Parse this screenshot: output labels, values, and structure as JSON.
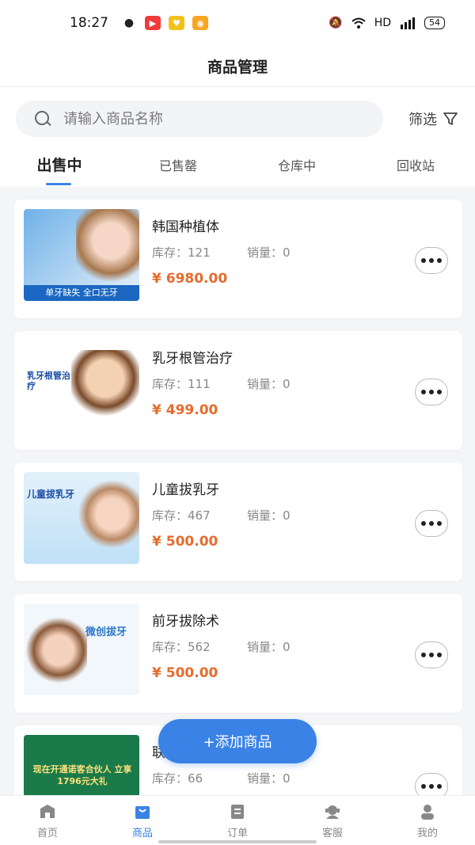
{
  "status_bar": {
    "time": "18:27",
    "network": "HD",
    "battery": "54"
  },
  "header": {
    "title": "商品管理"
  },
  "search": {
    "placeholder": "请输入商品名称",
    "filter_label": "筛选"
  },
  "tabs": [
    {
      "label": "出售中",
      "active": true
    },
    {
      "label": "已售罄",
      "active": false
    },
    {
      "label": "仓库中",
      "active": false
    },
    {
      "label": "回收站",
      "active": false
    }
  ],
  "products": [
    {
      "name": "韩国种植体",
      "stock_label": "库存：121",
      "sales_label": "销量：0",
      "price": "¥ 6980.00",
      "thumb_text": "单牙缺失 全口无牙"
    },
    {
      "name": "乳牙根管治疗",
      "stock_label": "库存：111",
      "sales_label": "销量：0",
      "price": "¥ 499.00",
      "thumb_text": "乳牙根管治疗"
    },
    {
      "name": "儿童拔乳牙",
      "stock_label": "库存：467",
      "sales_label": "销量：0",
      "price": "¥ 500.00",
      "thumb_text": "儿童拔乳牙"
    },
    {
      "name": "前牙拔除术",
      "stock_label": "库存：562",
      "sales_label": "销量：0",
      "price": "¥ 500.00",
      "thumb_text": "微创拔牙"
    },
    {
      "name": "联",
      "stock_label": "库存：66",
      "sales_label": "销量：0",
      "price": "",
      "thumb_text": "现在开通诺客合伙人 立享1796元大礼"
    }
  ],
  "add_button": {
    "label": "+添加商品"
  },
  "bottom_nav": [
    {
      "label": "首页",
      "icon": "home-icon",
      "active": false
    },
    {
      "label": "商品",
      "icon": "bag-icon",
      "active": true
    },
    {
      "label": "订单",
      "icon": "order-icon",
      "active": false
    },
    {
      "label": "客服",
      "icon": "service-icon",
      "active": false
    },
    {
      "label": "我的",
      "icon": "profile-icon",
      "active": false
    }
  ],
  "colors": {
    "accent": "#3b82e6",
    "price": "#e66b2c"
  }
}
